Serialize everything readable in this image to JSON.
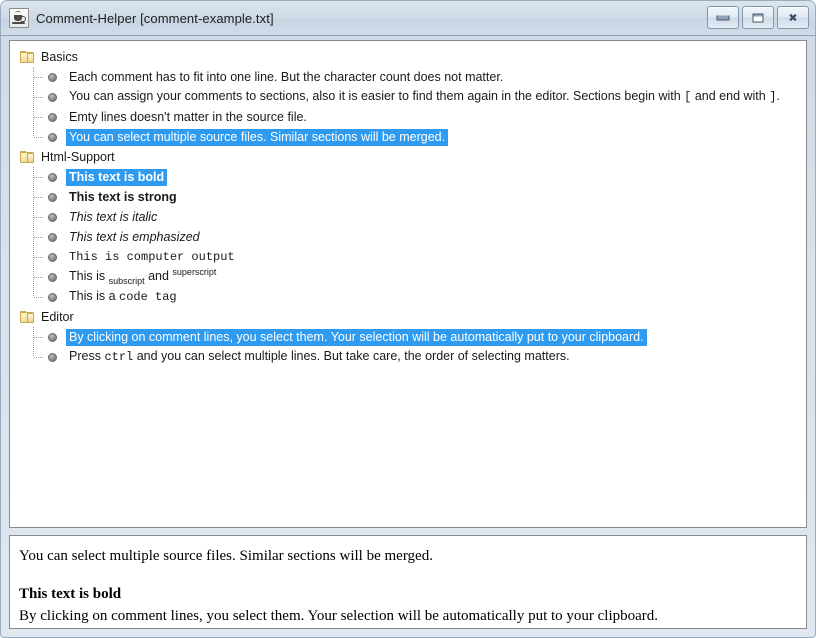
{
  "window": {
    "title": "Comment-Helper [comment-example.txt]",
    "app_icon": "java-cup-icon",
    "controls": {
      "minimize": "Minimize",
      "maximize": "Maximize",
      "close": "Close"
    }
  },
  "colors": {
    "selection": "#2e9bf0",
    "selection_text": "#ffffff",
    "titlebar": "#cdd9e6",
    "frame": "#d9e2ec",
    "panel_bg": "#ffffff",
    "panel_border": "#8a8a8a",
    "folder": "#f4dd97",
    "bullet": "#8d8d8d"
  },
  "tree": {
    "sections": [
      {
        "label": "Basics",
        "icon": "folder-icon",
        "items": [
          {
            "id": "basics-1",
            "selected": false,
            "parts": [
              {
                "text": "Each comment has to fit into one line. But the character count does not matter.",
                "style": "normal"
              }
            ]
          },
          {
            "id": "basics-2",
            "selected": false,
            "parts": [
              {
                "text": "You can assign your comments to sections, also it is easier to find them again in the editor. Sections begin with ",
                "style": "normal"
              },
              {
                "text": "[",
                "style": "mono"
              },
              {
                "text": " and end with ",
                "style": "normal"
              },
              {
                "text": "]",
                "style": "mono"
              },
              {
                "text": ".",
                "style": "normal"
              }
            ]
          },
          {
            "id": "basics-3",
            "selected": false,
            "parts": [
              {
                "text": "Emty lines doesn't matter in the source file.",
                "style": "normal"
              }
            ]
          },
          {
            "id": "basics-4",
            "selected": true,
            "parts": [
              {
                "text": "You can select multiple source files. Similar sections will be merged.",
                "style": "normal"
              }
            ]
          }
        ]
      },
      {
        "label": "Html-Support",
        "icon": "folder-icon",
        "items": [
          {
            "id": "html-1",
            "selected": true,
            "parts": [
              {
                "text": "This text is bold",
                "style": "bold"
              }
            ]
          },
          {
            "id": "html-2",
            "selected": false,
            "parts": [
              {
                "text": "This text is strong",
                "style": "bold"
              }
            ]
          },
          {
            "id": "html-3",
            "selected": false,
            "parts": [
              {
                "text": "This text is italic",
                "style": "italic"
              }
            ]
          },
          {
            "id": "html-4",
            "selected": false,
            "parts": [
              {
                "text": "This text is emphasized",
                "style": "italic"
              }
            ]
          },
          {
            "id": "html-5",
            "selected": false,
            "parts": [
              {
                "text": "This is computer output",
                "style": "mono"
              }
            ]
          },
          {
            "id": "html-6",
            "selected": false,
            "parts": [
              {
                "text": "This is ",
                "style": "normal"
              },
              {
                "text": "subscript",
                "style": "sub"
              },
              {
                "text": " and ",
                "style": "normal"
              },
              {
                "text": "superscript",
                "style": "sup"
              }
            ]
          },
          {
            "id": "html-7",
            "selected": false,
            "parts": [
              {
                "text": "This is a ",
                "style": "normal"
              },
              {
                "text": "code tag",
                "style": "mono"
              }
            ]
          }
        ]
      },
      {
        "label": "Editor",
        "icon": "folder-icon",
        "items": [
          {
            "id": "editor-1",
            "selected": true,
            "parts": [
              {
                "text": "By clicking on comment lines, you select them. Your selection will be automatically put to your clipboard.",
                "style": "normal"
              }
            ]
          },
          {
            "id": "editor-2",
            "selected": false,
            "parts": [
              {
                "text": "Press ",
                "style": "normal"
              },
              {
                "text": "ctrl",
                "style": "mono"
              },
              {
                "text": " and you can select multiple lines. But take care, the order of selecting matters.",
                "style": "normal"
              }
            ]
          }
        ]
      }
    ]
  },
  "preview": {
    "lines": [
      {
        "text": "You can select multiple source files. Similar sections will be merged.",
        "style": "normal"
      },
      {
        "text": "",
        "style": "spacer"
      },
      {
        "text": "This text is bold",
        "style": "bold"
      },
      {
        "text": "By clicking on comment lines, you select them. Your selection will be automatically put to your clipboard.",
        "style": "normal"
      }
    ]
  }
}
